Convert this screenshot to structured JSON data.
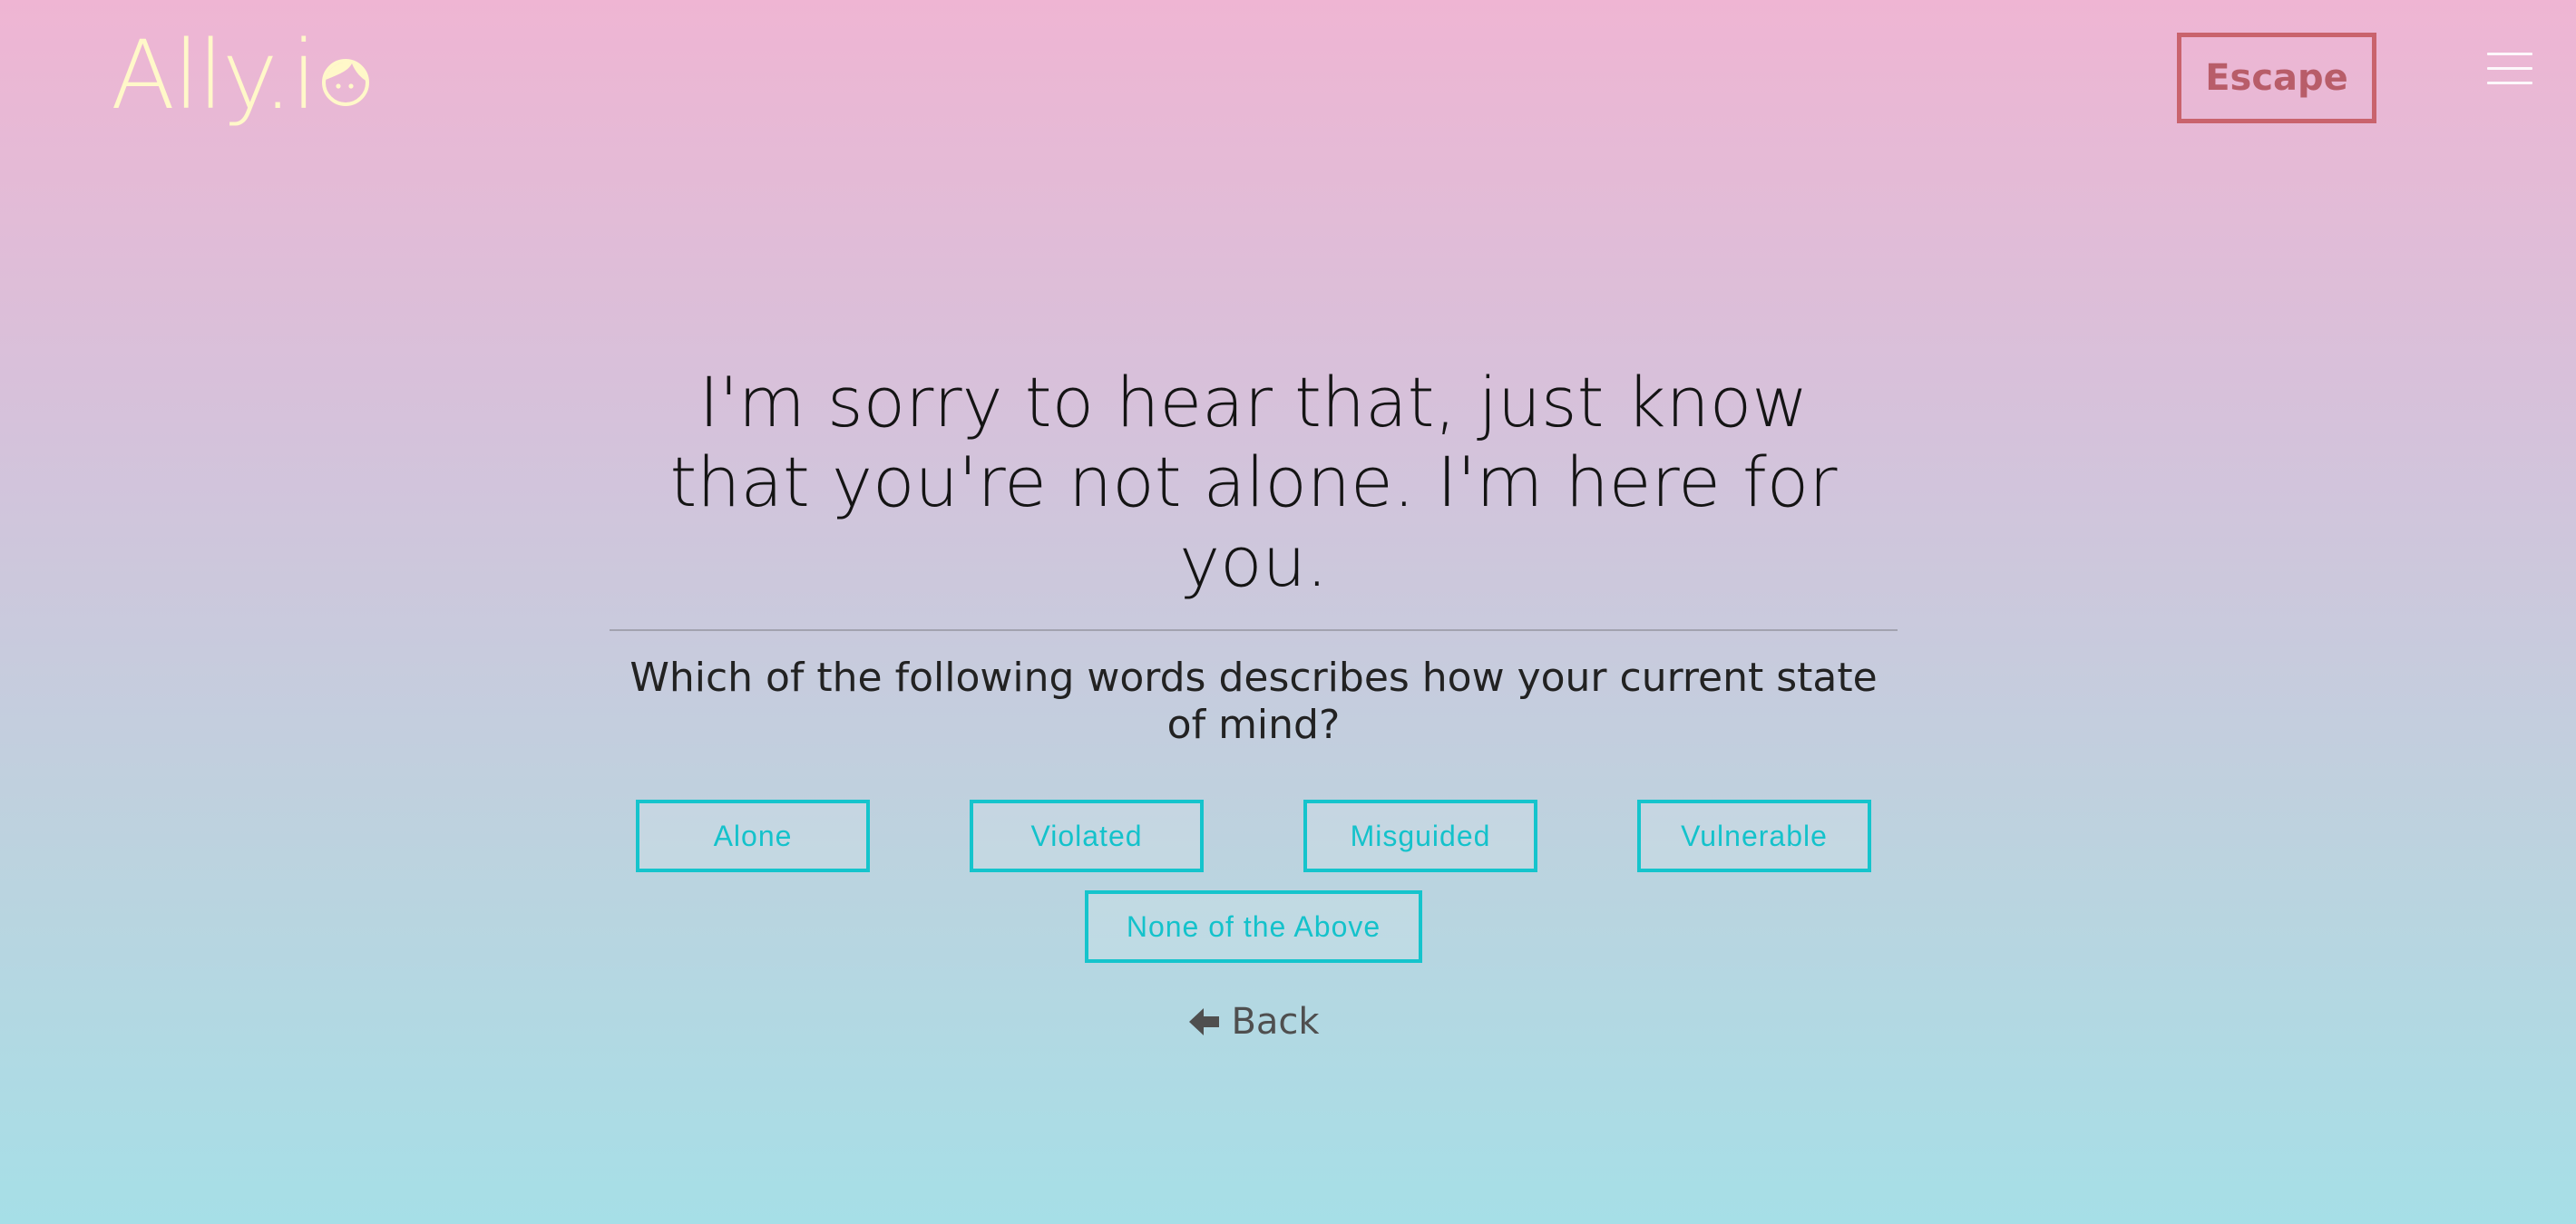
{
  "header": {
    "logo_text": "Ally.i",
    "escape_label": "Escape"
  },
  "main": {
    "headline": "I'm sorry to hear that, just know that you're not alone. I'm here for you.",
    "question": "Which of the following words describes how your current state of mind?",
    "options": [
      {
        "label": "Alone"
      },
      {
        "label": "Violated"
      },
      {
        "label": "Misguided"
      },
      {
        "label": "Vulnerable"
      }
    ],
    "none_option": {
      "label": "None of the Above"
    },
    "back_label": "Back"
  },
  "icons": {
    "logo_face": "face-icon",
    "menu": "hamburger-menu-icon",
    "back": "arrow-left-icon"
  },
  "colors": {
    "logo": "#fff8c9",
    "escape": "#c9636d",
    "option_accent": "#15c4cc",
    "gradient_top": "#efb5d3",
    "gradient_bottom": "#a6dfe7"
  }
}
